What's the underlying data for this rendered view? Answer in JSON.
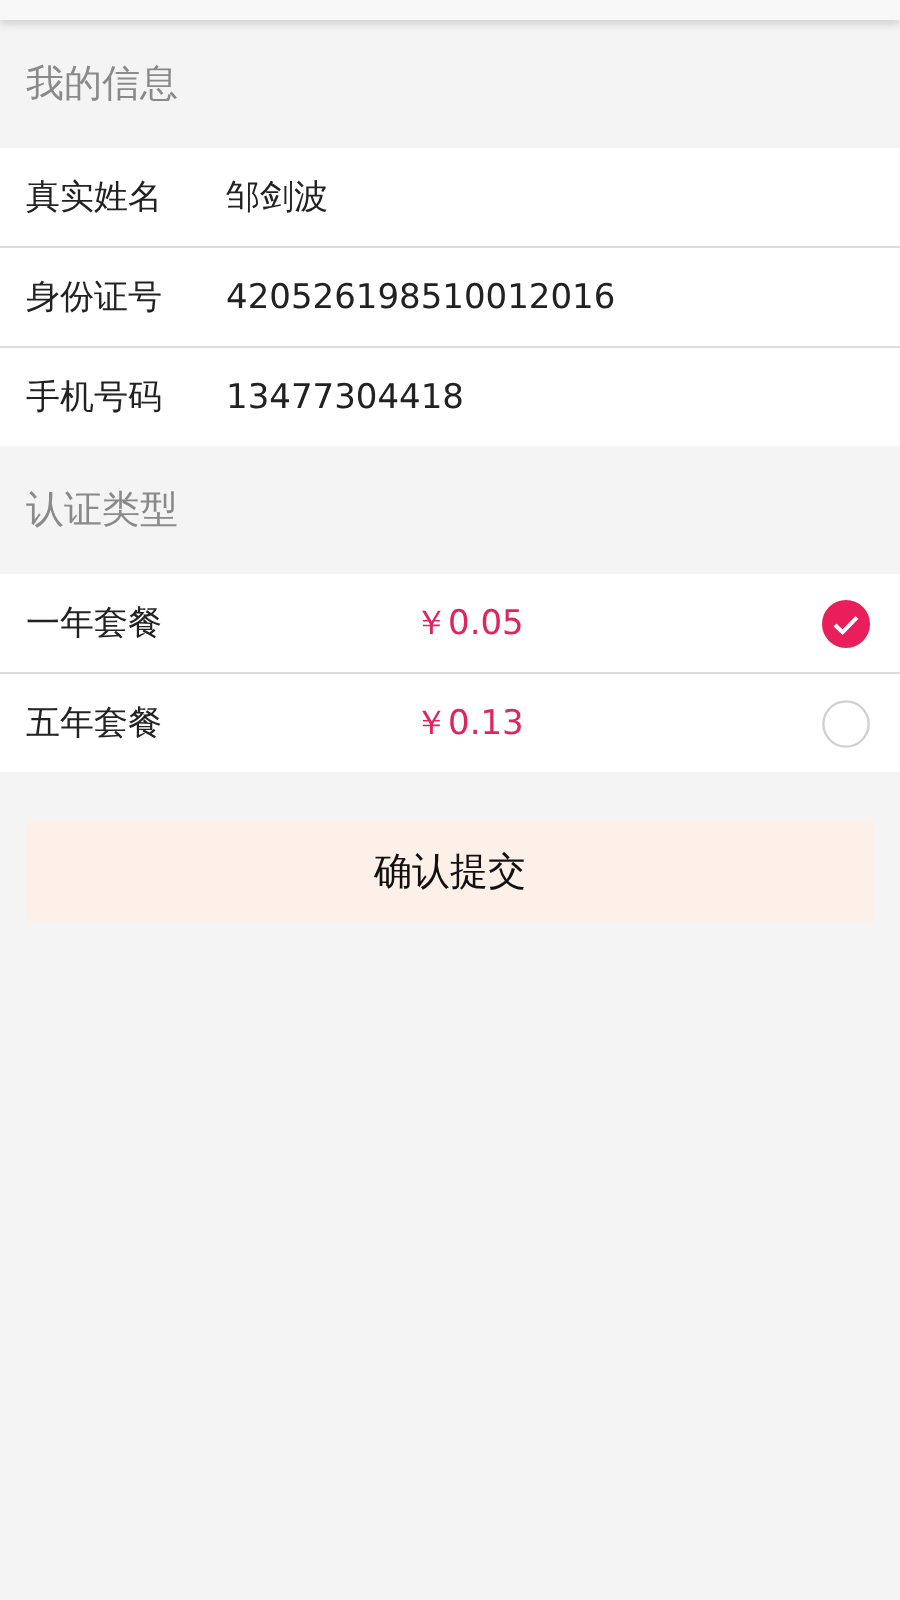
{
  "info_section": {
    "title": "我的信息"
  },
  "info_rows": [
    {
      "label": "真实姓名",
      "value": "邹剑波"
    },
    {
      "label": "身份证号",
      "value": "420526198510012016"
    },
    {
      "label": "手机号码",
      "value": "13477304418"
    }
  ],
  "plan_section": {
    "title": "认证类型"
  },
  "plans": [
    {
      "name": "一年套餐",
      "price": "￥0.05",
      "selected": true
    },
    {
      "name": "五年套餐",
      "price": "￥0.13",
      "selected": false
    }
  ],
  "submit_button": {
    "label": "确认提交"
  }
}
